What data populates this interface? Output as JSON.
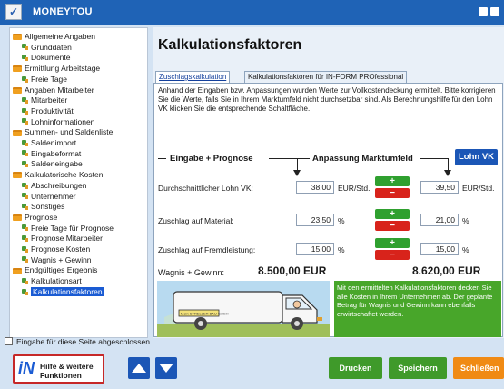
{
  "window": {
    "title": "MONEYTOU",
    "app_icon_glyph": "✓"
  },
  "sidebar": {
    "items": [
      {
        "label": "Allgemeine Angaben",
        "type": "folder",
        "level": 0
      },
      {
        "label": "Grunddaten",
        "type": "leaf",
        "level": 1
      },
      {
        "label": "Dokumente",
        "type": "leaf",
        "level": 1
      },
      {
        "label": "Ermittlung Arbeitstage",
        "type": "folder",
        "level": 0
      },
      {
        "label": "Freie Tage",
        "type": "leaf",
        "level": 1
      },
      {
        "label": "Angaben Mitarbeiter",
        "type": "folder",
        "level": 0
      },
      {
        "label": "Mitarbeiter",
        "type": "leaf",
        "level": 1
      },
      {
        "label": "Produktivität",
        "type": "leaf",
        "level": 1
      },
      {
        "label": "Lohninformationen",
        "type": "leaf",
        "level": 1
      },
      {
        "label": "Summen- und Saldenliste",
        "type": "folder",
        "level": 0
      },
      {
        "label": "Saldenimport",
        "type": "leaf",
        "level": 1
      },
      {
        "label": "Eingabeformat",
        "type": "leaf",
        "level": 1
      },
      {
        "label": "Saldeneingabe",
        "type": "leaf",
        "level": 1
      },
      {
        "label": "Kalkulatorische Kosten",
        "type": "folder",
        "level": 0
      },
      {
        "label": "Abschreibungen",
        "type": "leaf",
        "level": 1
      },
      {
        "label": "Unternehmer",
        "type": "leaf",
        "level": 1
      },
      {
        "label": "Sonstiges",
        "type": "leaf",
        "level": 1
      },
      {
        "label": "Prognose",
        "type": "folder",
        "level": 0
      },
      {
        "label": "Freie Tage für Prognose",
        "type": "leaf",
        "level": 1
      },
      {
        "label": "Prognose Mitarbeiter",
        "type": "leaf",
        "level": 1
      },
      {
        "label": "Prognose Kosten",
        "type": "leaf",
        "level": 1
      },
      {
        "label": "Wagnis + Gewinn",
        "type": "leaf",
        "level": 1
      },
      {
        "label": "Endgültiges Ergebnis",
        "type": "folder",
        "level": 0
      },
      {
        "label": "Kalkulationsart",
        "type": "leaf",
        "level": 1
      },
      {
        "label": "Kalkulationsfaktoren",
        "type": "leaf",
        "level": 1,
        "selected": true
      }
    ]
  },
  "main": {
    "title": "Kalkulationsfaktoren",
    "tabs": [
      {
        "label": "Zuschlagskalkulation",
        "active": true
      },
      {
        "label": "Kalkulationsfaktoren für IN-FORM PROfessional",
        "active": false
      }
    ],
    "intro": "Anhand der Eingaben bzw. Anpassungen wurden Werte zur Vollkostendeckung ermittelt. Bitte korrigieren Sie die Werte, falls Sie in Ihrem Marktumfeld nicht durchsetzbar sind. Als Berechnungshilfe für den Lohn VK klicken Sie die entsprechende Schaltfläche.",
    "header_left": "Eingabe + Prognose",
    "header_right": "Anpassung Marktumfeld",
    "lohn_vk_button": "Lohn VK",
    "step_plus": "+",
    "step_minus": "−",
    "rows": [
      {
        "label": "Durchschnittlicher Lohn VK:",
        "input_value": "38,00",
        "unit": "EUR/Std.",
        "market_value": "39,50",
        "market_unit": "EUR/Std."
      },
      {
        "label": "Zuschlag auf Material:",
        "input_value": "23,50",
        "unit": "%",
        "market_value": "21,00",
        "market_unit": "%"
      },
      {
        "label": "Zuschlag auf Fremdleistung:",
        "input_value": "15,00",
        "unit": "%",
        "market_value": "15,00",
        "market_unit": "%"
      }
    ],
    "wagnis_label": "Wagnis + Gewinn:",
    "wagnis_input_total": "8.500,00 EUR",
    "wagnis_market_total": "8.620,00 EUR",
    "info_text": "Mit den ermittelten Kalkulationsfaktoren decken Sie alle Kosten in Ihrem Unternehmen ab. Der geplante Betrag für Wagnis und Gewinn kann ebenfalls erwirtschaftet werden.",
    "illustration_sign": "Mein STRELLER BAU GmbH"
  },
  "footer": {
    "checkbox_label": "Eingabe für diese Seite abgeschlossen",
    "help_label": "Hilfe & weitere Funktionen",
    "help_icon_glyph": "iN",
    "print_label": "Drucken",
    "save_label": "Speichern",
    "close_label": "Schließen"
  },
  "colors": {
    "title_bar": "#1f63b6",
    "accent_blue": "#1b56b6",
    "plus_green": "#2fa02f",
    "minus_red": "#d8231b",
    "info_green": "#48a62a",
    "close_orange": "#f08a14",
    "print_green": "#3f9a2a"
  }
}
